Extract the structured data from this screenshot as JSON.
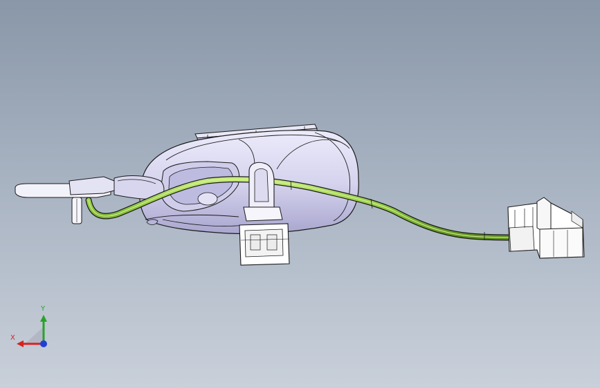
{
  "viewport": {
    "background_top": "#8997a8",
    "background_bottom": "#c9d0da"
  },
  "model": {
    "housing_color": "#d9d7ef",
    "edge_color": "#1a1a1a",
    "cable_color": "#8dc63f",
    "connector_color": "#ffffff"
  },
  "triad": {
    "x_label": "X",
    "y_label": "Y",
    "x_color": "#d62222",
    "y_color": "#27a327",
    "z_color": "#1f3fd6",
    "origin_icon": "triad-origin-icon"
  }
}
